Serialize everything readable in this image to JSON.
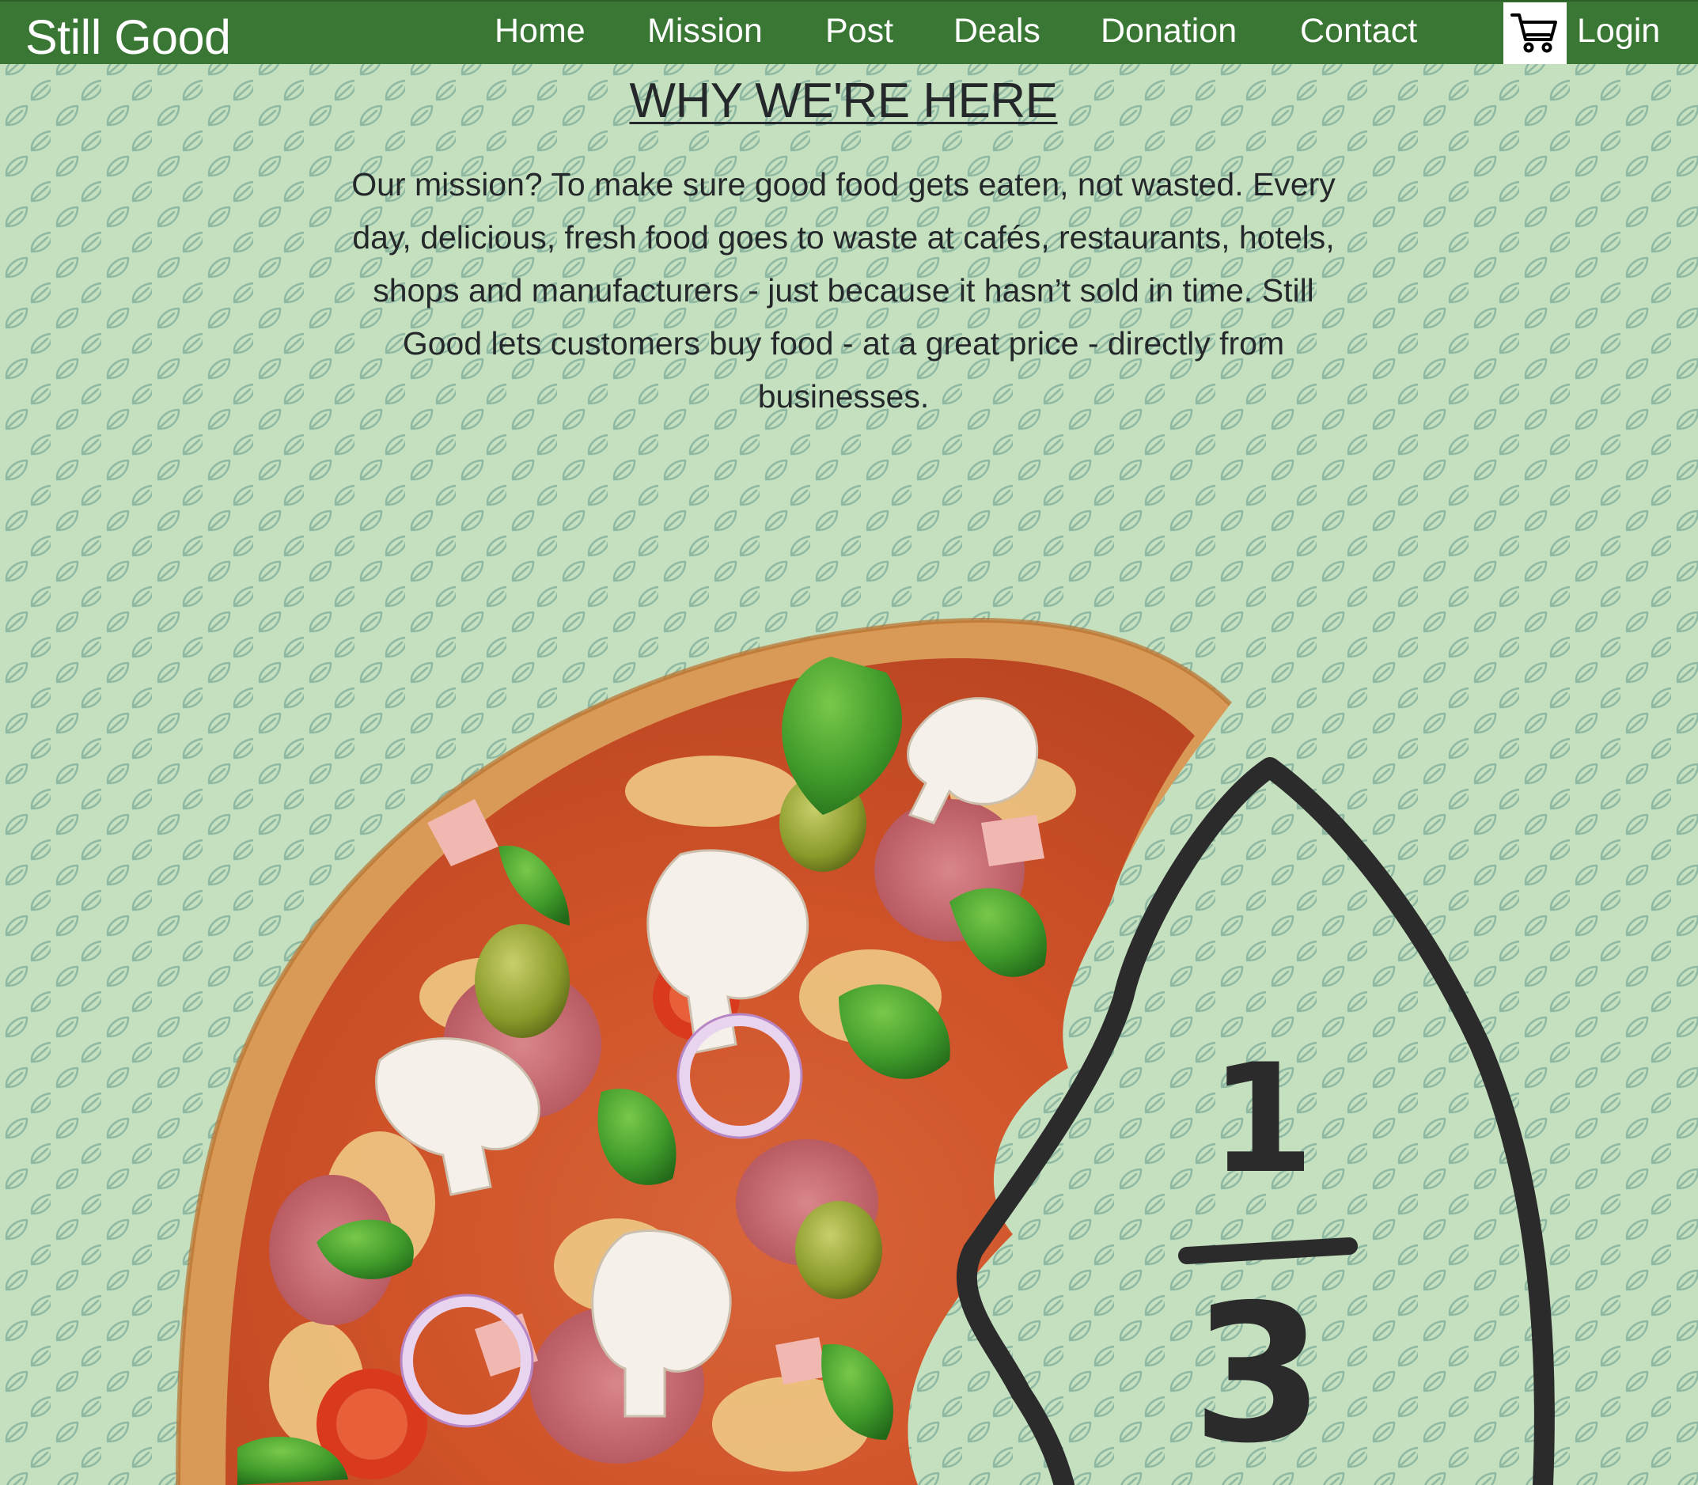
{
  "navbar": {
    "brand": "Still Good",
    "links": [
      "Home",
      "Mission",
      "Post",
      "Deals",
      "Donation",
      "Contact"
    ],
    "cart_icon": "cart-icon",
    "login_label": "Login"
  },
  "mission": {
    "heading": "WHY WE'RE HERE",
    "paragraph": "Our mission? To make sure good food gets eaten, not wasted. Every day, delicious, fresh food goes to waste at cafés, restaurants, hotels, shops and manufacturers - just because it hasn’t sold in time. Still Good lets customers buy food - at a great price - directly from businesses."
  },
  "illustration": {
    "fraction_numerator": "1",
    "fraction_denominator": "3"
  },
  "colors": {
    "navbar": "#3a7734",
    "background": "#c4e0bf",
    "leaf_pattern": "#8fb9a3",
    "text": "#25282a",
    "ink": "#2b2b2b"
  }
}
